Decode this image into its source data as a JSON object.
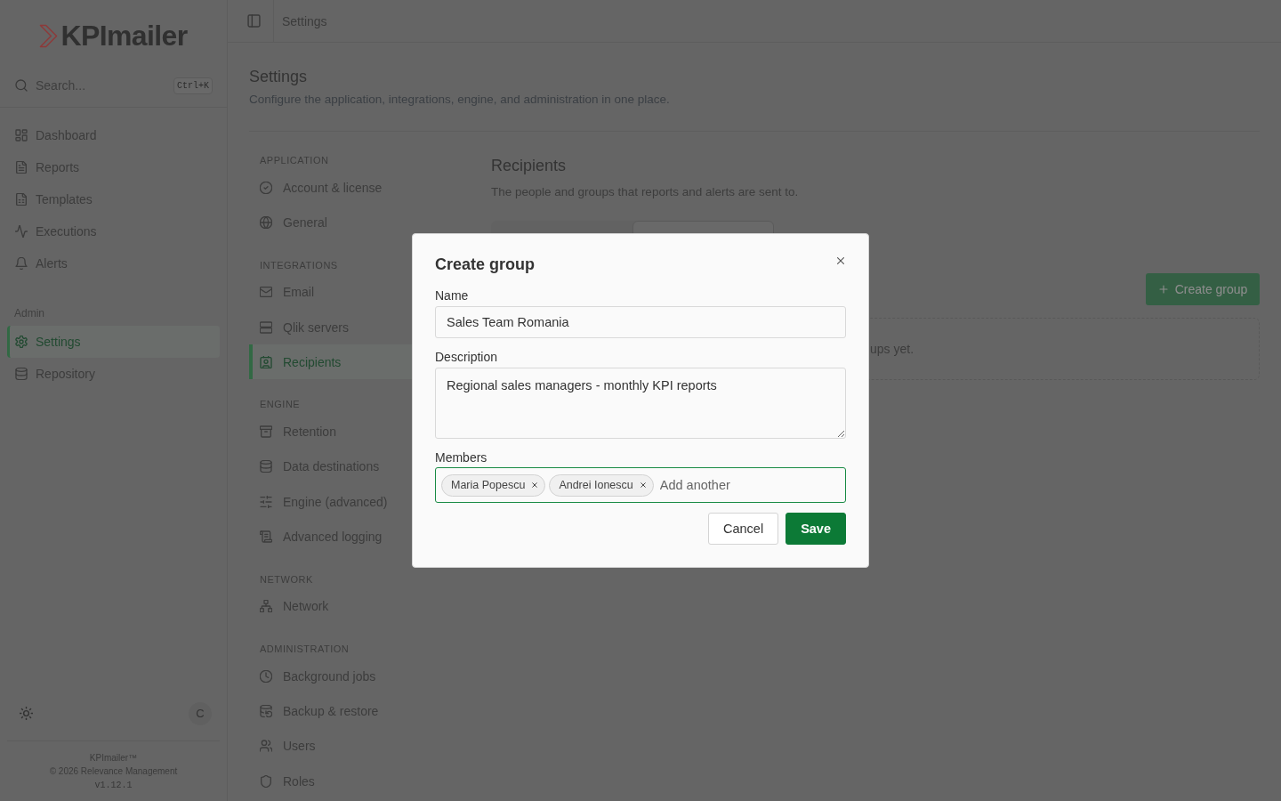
{
  "sidebar": {
    "logo": "KPImailer",
    "search": {
      "placeholder": "Search...",
      "shortcut": "Ctrl+K"
    },
    "nav": [
      {
        "label": "Dashboard",
        "selected": false
      },
      {
        "label": "Reports",
        "selected": false
      },
      {
        "label": "Templates",
        "selected": false
      },
      {
        "label": "Executions",
        "selected": false
      },
      {
        "label": "Alerts",
        "selected": false
      }
    ],
    "admin": {
      "heading": "Admin",
      "items": [
        {
          "label": "Settings",
          "selected": true
        },
        {
          "label": "Repository",
          "selected": false
        }
      ]
    },
    "avatar": "C",
    "footer": {
      "product": "KPImailer™",
      "copyright": "© 2026 Relevance Management",
      "version": "v1.12.1"
    }
  },
  "topbar": {
    "breadcrumb": "Settings"
  },
  "page": {
    "title": "Settings",
    "subtitle": "Configure the application, integrations, engine, and administration in one place."
  },
  "settings_nav": [
    {
      "heading": "APPLICATION",
      "items": [
        {
          "label": "Account & license",
          "selected": false
        },
        {
          "label": "General",
          "selected": false
        }
      ]
    },
    {
      "heading": "INTEGRATIONS",
      "items": [
        {
          "label": "Email",
          "selected": false
        },
        {
          "label": "Qlik servers",
          "selected": false
        },
        {
          "label": "Recipients",
          "selected": true
        }
      ]
    },
    {
      "heading": "ENGINE",
      "items": [
        {
          "label": "Retention",
          "selected": false
        },
        {
          "label": "Data destinations",
          "selected": false
        },
        {
          "label": "Engine (advanced)",
          "selected": false
        },
        {
          "label": "Advanced logging",
          "selected": false
        }
      ]
    },
    {
      "heading": "NETWORK",
      "items": [
        {
          "label": "Network",
          "selected": false
        }
      ]
    },
    {
      "heading": "ADMINISTRATION",
      "items": [
        {
          "label": "Background jobs",
          "selected": false
        },
        {
          "label": "Backup & restore",
          "selected": false
        },
        {
          "label": "Users",
          "selected": false
        },
        {
          "label": "Roles",
          "selected": false
        }
      ]
    }
  ],
  "recipients": {
    "title": "Recipients",
    "subtitle": "The people and groups that reports and alerts are sent to.",
    "tabs": [
      {
        "selected": false
      },
      {
        "selected": true
      }
    ],
    "create_button": "Create group",
    "empty_text": "ups yet."
  },
  "dialog": {
    "title": "Create group",
    "fields": [
      {
        "kind": "text",
        "label": "Name",
        "value": "Sales Team Romania",
        "focused": false
      },
      {
        "kind": "textarea",
        "label": "Description",
        "value": "Regional sales managers - monthly KPI reports",
        "focused": false
      },
      {
        "kind": "tags",
        "label": "Members",
        "tags": [
          "Maria Popescu",
          "Andrei Ionescu"
        ],
        "placeholder": "Add another",
        "focused": true
      }
    ],
    "buttons": [
      {
        "label": "Cancel",
        "kind": "secondary"
      },
      {
        "label": "Save",
        "kind": "primary"
      }
    ]
  }
}
